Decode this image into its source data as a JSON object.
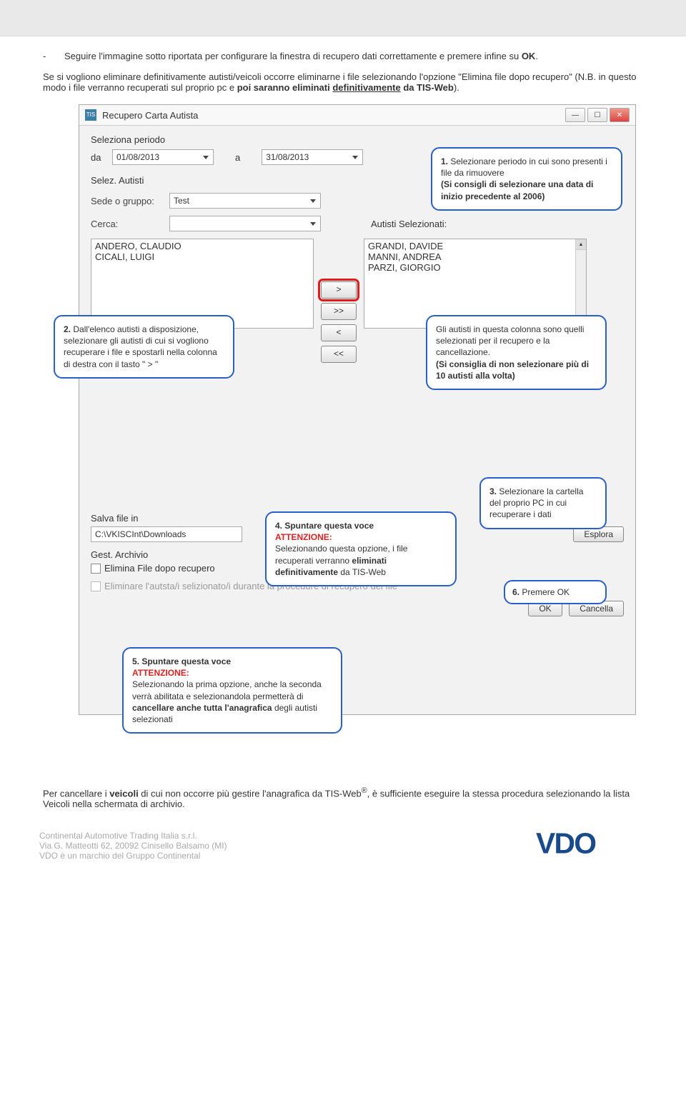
{
  "intro": {
    "bullet": "-",
    "line1a": "Seguire l'immagine sotto riportata per configurare la finestra di recupero dati correttamente e premere infine su ",
    "line1b": "OK",
    "line1c": ".",
    "line2a": "Se si vogliono eliminare definitivamente autisti/veicoli occorre eliminarne i file selezionando l'opzione \"Elimina file dopo recupero\" (N.B. in questo modo i file verranno recuperati sul proprio pc e ",
    "line2b": "poi saranno eliminati ",
    "line2c": "definitivamente",
    "line2d": " da TIS-Web",
    "line2e": ")."
  },
  "window": {
    "icon_text": "TIS",
    "title": "Recupero Carta Autista",
    "seleziona_periodo": "Seleziona periodo",
    "da": "da",
    "date_from": "01/08/2013",
    "a": "a",
    "date_to": "31/08/2013",
    "selez_autisti": "Selez. Autisti",
    "sede_o_gruppo": "Sede o gruppo:",
    "sede_value": "Test",
    "cerca": "Cerca:",
    "autisti_selezionati": "Autisti Selezionati:",
    "left_list": [
      "ANDERO, CLAUDIO",
      "CICALI, LUIGI"
    ],
    "right_list": [
      "GRANDI, DAVIDE",
      "MANNI, ANDREA",
      "PARZI, GIORGIO"
    ],
    "move_buttons": [
      ">",
      ">>",
      "<",
      "<<"
    ],
    "salva_file_in": "Salva file in",
    "save_path": "C:\\VKISCInt\\Downloads",
    "esplora": "Esplora",
    "gest_archivio": "Gest. Archivio",
    "chk1": "Elimina File dopo recupero",
    "chk2": "Eliminare l'autsta/i selizionato/i durante la procedure di recupero dei file",
    "ok": "OK",
    "cancella": "Cancella",
    "minimize_icon": "—",
    "maximize_icon": "☐",
    "close_icon": "✕",
    "scroll_up_icon": "▲",
    "scroll_down_icon": "▼"
  },
  "callouts": {
    "c1": {
      "num": "1.",
      "text": " Selezionare periodo in cui sono presenti i file da rimuovere",
      "sub": "(Si consigli di selezionare una data di inizio precedente al 2006)"
    },
    "c2": {
      "num": "2.",
      "text": " Dall'elenco autisti a disposizione, selezionare gli autisti di cui si vogliono recuperare i file e spostarli nella colonna di destra con il tasto \" > \""
    },
    "c3": {
      "text": "Gli autisti in questa colonna sono quelli selezionati per il recupero e la cancellazione.",
      "sub": "(Si consiglia di non selezionare più di 10 autisti alla volta)"
    },
    "c4": {
      "num": "4.",
      "title": " Spuntare questa voce",
      "warn": "ATTENZIONE:",
      "text": "Selezionando questa opzione, i file recuperati verranno ",
      "bold": "eliminati definitivamente",
      "text2": " da TIS-Web"
    },
    "c5": {
      "num": "3.",
      "text": " Selezionare la cartella del proprio PC in cui recuperare i dati"
    },
    "c6": {
      "num": "6.",
      "text": " Premere OK"
    },
    "c7": {
      "num": "5.",
      "title": " Spuntare questa voce",
      "warn": "ATTENZIONE:",
      "text": "Selezionando la prima opzione, anche la seconda verrà abilitata e selezionandola permetterà di ",
      "bold": "cancellare anche tutta l'anagrafica",
      "text2": " degli autisti selezionati"
    }
  },
  "outro": {
    "p1a": "Per cancellare i ",
    "p1b": "veicoli",
    "p1c": " di cui non occorre più gestire l'anagrafica da TIS-Web",
    "p1d": "®",
    "p1e": ", è sufficiente eseguire la stessa procedura selezionando la lista Veicoli nella schermata di archivio."
  },
  "footer": {
    "line1": "Continental Automotive Trading Italia s.r.l.",
    "line2": "Via G. Matteotti 62, 20092 Cinisello Balsamo (MI)",
    "line3": "VDO è un marchio del Gruppo Continental",
    "logo_text": "VDO"
  }
}
